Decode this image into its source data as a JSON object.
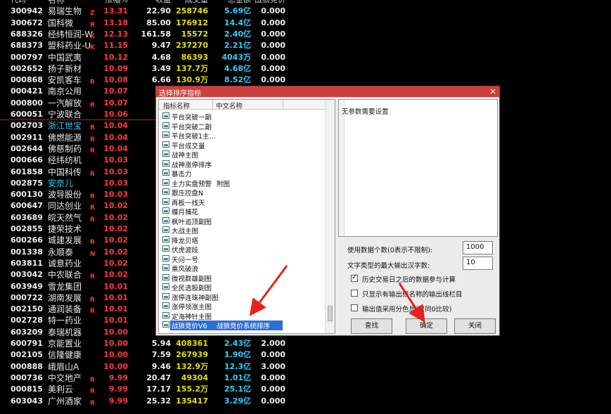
{
  "table": {
    "headers": {
      "code": "代码",
      "name": "名称",
      "pct": "涨幅%",
      "price": "收盘",
      "vol": "成交量",
      "amt": "总金额",
      "ratio": "战狼竞价"
    },
    "rows": [
      {
        "code": "300942",
        "name": "易瑞生物",
        "flag": "Z",
        "pct": "13.31",
        "price": "22.90",
        "vol": "258746",
        "amt": "5.69亿",
        "ratio": "0.000"
      },
      {
        "code": "300672",
        "name": "国科微",
        "flag": "R",
        "pct": "13.18",
        "price": "85.00",
        "vol": "176912",
        "amt": "14.4亿",
        "ratio": "0.000"
      },
      {
        "code": "688326",
        "name": "经纬恒润-W",
        "flag": "K",
        "pct": "12.13",
        "price": "161.58",
        "vol": "15572",
        "amt": "2.40亿",
        "ratio": "0.000"
      },
      {
        "code": "688373",
        "name": "盟科药业-U",
        "flag": "K",
        "pct": "11.15",
        "price": "9.47",
        "vol": "237270",
        "amt": "2.21亿",
        "ratio": "0.000"
      },
      {
        "code": "000797",
        "name": "中国武夷",
        "flag": "",
        "pct": "10.12",
        "price": "4.68",
        "vol": "86393",
        "amt": "4043万",
        "ratio": "0.000"
      },
      {
        "code": "002652",
        "name": "扬子新材",
        "flag": "",
        "pct": "10.09",
        "price": "3.49",
        "vol": "137.7万",
        "amt": "4.68亿",
        "ratio": "0.000"
      },
      {
        "code": "000868",
        "name": "安凯客车",
        "flag": "R",
        "pct": "10.08",
        "price": "6.66",
        "vol": "130.9万",
        "amt": "8.52亿",
        "ratio": "0.000"
      },
      {
        "code": "000421",
        "name": "南京公用",
        "flag": "",
        "pct": "10.07",
        "price": "",
        "vol": "",
        "amt": "",
        "ratio": ""
      },
      {
        "code": "000800",
        "name": "一汽解放",
        "flag": "R",
        "pct": "10.07",
        "price": "",
        "vol": "",
        "amt": "",
        "ratio": ""
      },
      {
        "code": "600051",
        "name": "宁波联合",
        "flag": "",
        "pct": "10.06",
        "price": "",
        "vol": "",
        "amt": "",
        "ratio": ""
      },
      {
        "code": "002703",
        "name": "浙江世宝",
        "flag": "R",
        "pct": "10.04",
        "price": "1",
        "vol": "",
        "amt": "",
        "ratio": "",
        "cyan": true
      },
      {
        "code": "002911",
        "name": "佛燃能源",
        "flag": "R",
        "pct": "10.04",
        "price": "1",
        "vol": "",
        "amt": "",
        "ratio": ""
      },
      {
        "code": "002644",
        "name": "佛慈制药",
        "flag": "R",
        "pct": "10.04",
        "price": "1",
        "vol": "",
        "amt": "",
        "ratio": ""
      },
      {
        "code": "000666",
        "name": "经纬纺机",
        "flag": "",
        "pct": "10.03",
        "price": "1",
        "vol": "",
        "amt": "",
        "ratio": ""
      },
      {
        "code": "601858",
        "name": "中国科传",
        "flag": "R",
        "pct": "10.03",
        "price": "1",
        "vol": "",
        "amt": "",
        "ratio": ""
      },
      {
        "code": "002875",
        "name": "安奈儿",
        "flag": "",
        "pct": "10.03",
        "price": "1",
        "vol": "",
        "amt": "",
        "ratio": "",
        "cyan": true
      },
      {
        "code": "600130",
        "name": "波导股份",
        "flag": "R",
        "pct": "10.03",
        "price": "",
        "vol": "",
        "amt": "",
        "ratio": ""
      },
      {
        "code": "600647",
        "name": "同达创业",
        "flag": "R",
        "pct": "10.02",
        "price": "1",
        "vol": "",
        "amt": "",
        "ratio": ""
      },
      {
        "code": "603689",
        "name": "皖天然气",
        "flag": "R",
        "pct": "10.02",
        "price": "",
        "vol": "",
        "amt": "",
        "ratio": ""
      },
      {
        "code": "002855",
        "name": "捷荣技术",
        "flag": "",
        "pct": "10.02",
        "price": "",
        "vol": "",
        "amt": "",
        "ratio": ""
      },
      {
        "code": "600266",
        "name": "城建发展",
        "flag": "R",
        "pct": "10.02",
        "price": "",
        "vol": "",
        "amt": "",
        "ratio": ""
      },
      {
        "code": "001338",
        "name": "永顺泰",
        "flag": "N",
        "pct": "10.02",
        "price": "2",
        "vol": "",
        "amt": "",
        "ratio": ""
      },
      {
        "code": "603811",
        "name": "诚意药业",
        "flag": "",
        "pct": "10.02",
        "price": "1",
        "vol": "",
        "amt": "",
        "ratio": ""
      },
      {
        "code": "003042",
        "name": "中农联合",
        "flag": "R",
        "pct": "10.02",
        "price": "",
        "vol": "",
        "amt": "",
        "ratio": ""
      },
      {
        "code": "603949",
        "name": "雪龙集团",
        "flag": "",
        "pct": "10.01",
        "price": "1",
        "vol": "",
        "amt": "",
        "ratio": ""
      },
      {
        "code": "000722",
        "name": "湖南发展",
        "flag": "R",
        "pct": "10.01",
        "price": "1",
        "vol": "",
        "amt": "",
        "ratio": ""
      },
      {
        "code": "002150",
        "name": "通润装备",
        "flag": "R",
        "pct": "10.01",
        "price": "1",
        "vol": "",
        "amt": "",
        "ratio": ""
      },
      {
        "code": "002728",
        "name": "特一药业",
        "flag": "",
        "pct": "10.01",
        "price": "3",
        "vol": "",
        "amt": "",
        "ratio": ""
      },
      {
        "code": "603209",
        "name": "泰瑞机器",
        "flag": "",
        "pct": "10.00",
        "price": "1",
        "vol": "",
        "amt": "",
        "ratio": ""
      },
      {
        "code": "600791",
        "name": "京能置业",
        "flag": "",
        "pct": "10.00",
        "price": "5.94",
        "vol": "408361",
        "amt": "2.43亿",
        "ratio": "2.000"
      },
      {
        "code": "002105",
        "name": "信隆健康",
        "flag": "",
        "pct": "10.00",
        "price": "7.59",
        "vol": "267939",
        "amt": "1.90亿",
        "ratio": "0.000"
      },
      {
        "code": "000888",
        "name": "峨眉山A",
        "flag": "",
        "pct": "10.00",
        "price": "9.46",
        "vol": "132.9万",
        "amt": "12.3亿",
        "ratio": "3.000"
      },
      {
        "code": "000736",
        "name": "中交地产",
        "flag": "R",
        "pct": "9.99",
        "price": "20.47",
        "vol": "49304",
        "amt": "1.01亿",
        "ratio": "0.000"
      },
      {
        "code": "000815",
        "name": "美利云",
        "flag": "R",
        "pct": "9.99",
        "price": "17.17",
        "vol": "155.2万",
        "amt": "25.1亿",
        "ratio": "0.000"
      },
      {
        "code": "603043",
        "name": "广州酒家",
        "flag": "R",
        "pct": "9.99",
        "price": "25.32",
        "vol": "135417",
        "amt": "3.29亿",
        "ratio": "0.000"
      }
    ]
  },
  "dialog": {
    "title": "选择排序指标",
    "close_label": "×",
    "list_headers": {
      "col1": "指标名称",
      "col2": "中文名称"
    },
    "items": [
      {
        "n1": "平台突破一副",
        "n2": ""
      },
      {
        "n1": "平台突破二副",
        "n2": ""
      },
      {
        "n1": "平台突破1主...",
        "n2": ""
      },
      {
        "n1": "平台成交量",
        "n2": ""
      },
      {
        "n1": "战神主图",
        "n2": ""
      },
      {
        "n1": "战神涨停排序",
        "n2": ""
      },
      {
        "n1": "暴击力",
        "n2": ""
      },
      {
        "n1": "主力实盘预警",
        "n2": "附图"
      },
      {
        "n1": "跟庄控盘N",
        "n2": ""
      },
      {
        "n1": "再板一线天",
        "n2": ""
      },
      {
        "n1": "蝶月捕花",
        "n2": ""
      },
      {
        "n1": "枫叶追顶副图",
        "n2": ""
      },
      {
        "n1": "大战主图",
        "n2": ""
      },
      {
        "n1": "降龙贝塔",
        "n2": ""
      },
      {
        "n1": "伏虎波段",
        "n2": ""
      },
      {
        "n1": "天问一号",
        "n2": ""
      },
      {
        "n1": "乘风破浪",
        "n2": ""
      },
      {
        "n1": "微视群雄副图",
        "n2": ""
      },
      {
        "n1": "全民选股副图",
        "n2": ""
      },
      {
        "n1": "涨停连珠神副图",
        "n2": ""
      },
      {
        "n1": "涨停领涨主图",
        "n2": ""
      },
      {
        "n1": "定海神针主图",
        "n2": ""
      },
      {
        "n1": "战狼竞价V6",
        "n2": "战狼竞价系统排序"
      }
    ],
    "selected_index": 22,
    "description": "无参数需要设置",
    "opt_max_label": "使用数据个数(0表示不限制):",
    "opt_max_value": "1000",
    "opt_chars_label": "文字类型的最大输出汉字数:",
    "opt_chars_value": "10",
    "check1_label": "历史交易日之后的数据参与计算",
    "check2_label": "只显示有输出线名称的输出线栏目",
    "check3_label": "输出值采用分色显示(同0比较)",
    "btn_find": "查找",
    "btn_ok": "确定",
    "btn_close": "关闭"
  },
  "colors": {
    "up": "#ff3b3b",
    "code": "#f0f0f0",
    "vol": "#e8e000",
    "amt": "#30d0ff",
    "dialog_title": "#c8403f",
    "selection": "#2f6ed4",
    "arrow": "#e8201e"
  }
}
